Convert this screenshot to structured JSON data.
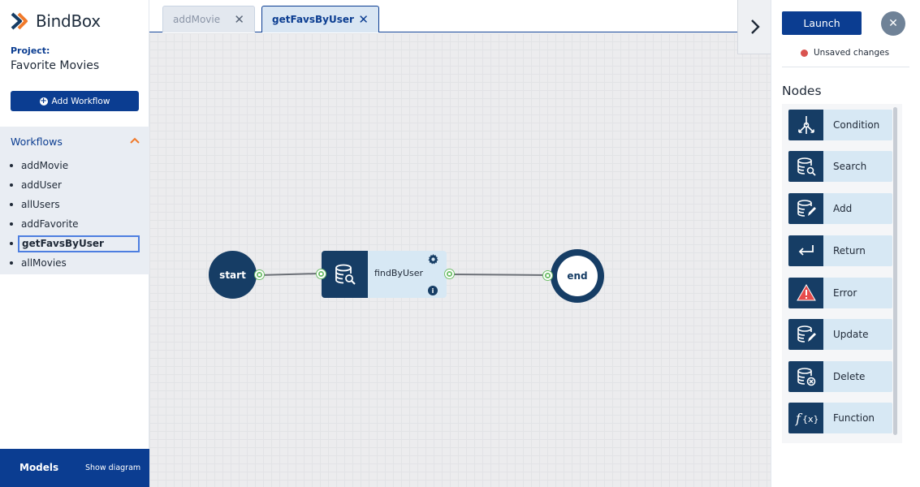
{
  "app": {
    "name": "BindBox"
  },
  "project": {
    "label": "Project:",
    "name": "Favorite Movies"
  },
  "sidebar": {
    "add_workflow_label": "Add Workflow",
    "workflows_title": "Workflows",
    "workflows": [
      "addMovie",
      "addUser",
      "allUsers",
      "addFavorite",
      "getFavsByUser",
      "allMovies"
    ],
    "active_workflow": "getFavsByUser",
    "models_title": "Models",
    "show_diagram_label": "Show diagram"
  },
  "tabs": [
    {
      "label": "addMovie",
      "active": false
    },
    {
      "label": "getFavsByUser",
      "active": true
    }
  ],
  "toolbar": {
    "launch_label": "Launch",
    "unsaved_label": "Unsaved changes"
  },
  "nodes_panel": {
    "title": "Nodes",
    "items": [
      {
        "label": "Condition",
        "icon": "condition-icon"
      },
      {
        "label": "Search",
        "icon": "search-db-icon"
      },
      {
        "label": "Add",
        "icon": "add-db-icon"
      },
      {
        "label": "Return",
        "icon": "return-icon"
      },
      {
        "label": "Error",
        "icon": "error-icon"
      },
      {
        "label": "Update",
        "icon": "update-db-icon"
      },
      {
        "label": "Delete",
        "icon": "delete-db-icon"
      },
      {
        "label": "Function",
        "icon": "function-icon"
      }
    ]
  },
  "diagram": {
    "start_label": "start",
    "end_label": "end",
    "node_label": "findByUser"
  },
  "colors": {
    "primary": "#0b3d91",
    "node_dark": "#163d65",
    "node_light": "#d7e8f4",
    "port": "#6fbf6a",
    "unsaved": "#d9534f"
  }
}
